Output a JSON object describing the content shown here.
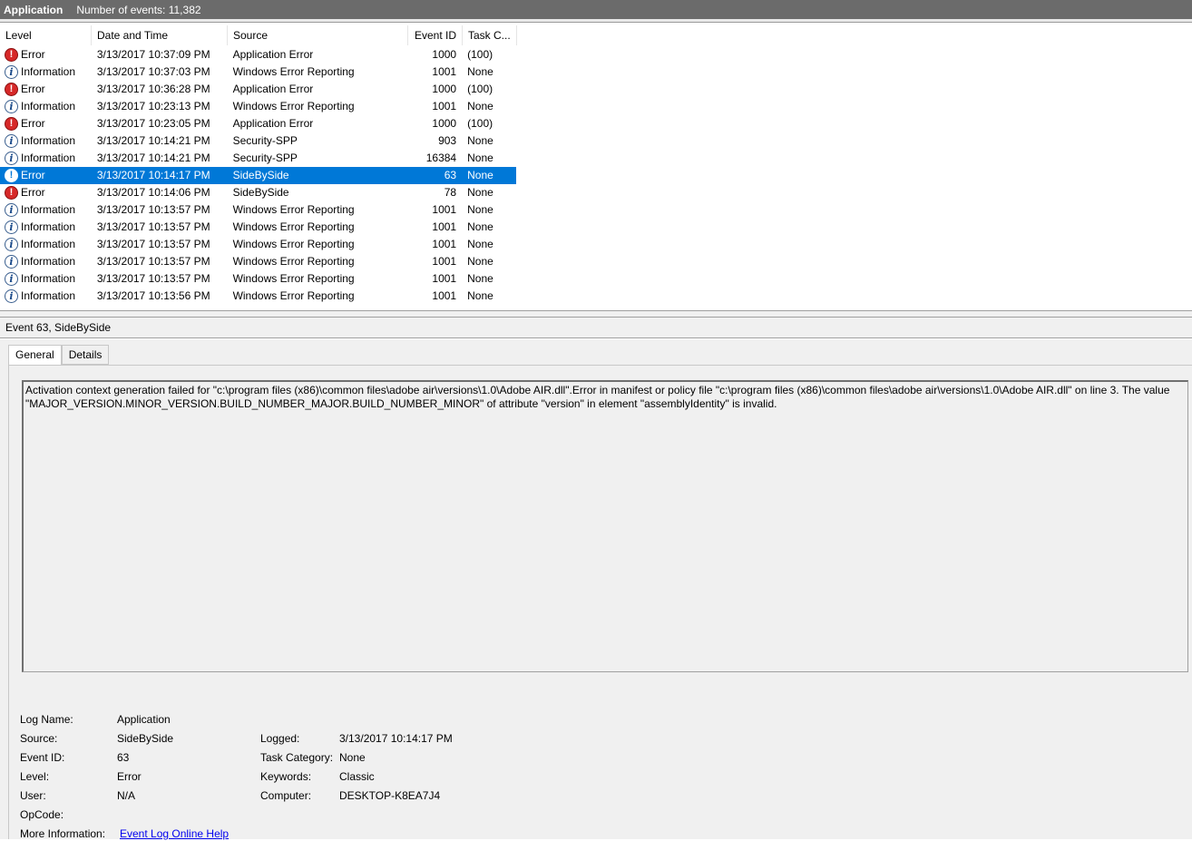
{
  "title": {
    "log_name": "Application",
    "count_text": "Number of events: 11,382"
  },
  "columns": {
    "level": "Level",
    "date": "Date and Time",
    "source": "Source",
    "event_id": "Event ID",
    "task": "Task C..."
  },
  "events": [
    {
      "level": "Error",
      "date": "3/13/2017 10:37:09 PM",
      "source": "Application Error",
      "event_id": "1000",
      "task": "(100)"
    },
    {
      "level": "Information",
      "date": "3/13/2017 10:37:03 PM",
      "source": "Windows Error Reporting",
      "event_id": "1001",
      "task": "None"
    },
    {
      "level": "Error",
      "date": "3/13/2017 10:36:28 PM",
      "source": "Application Error",
      "event_id": "1000",
      "task": "(100)"
    },
    {
      "level": "Information",
      "date": "3/13/2017 10:23:13 PM",
      "source": "Windows Error Reporting",
      "event_id": "1001",
      "task": "None"
    },
    {
      "level": "Error",
      "date": "3/13/2017 10:23:05 PM",
      "source": "Application Error",
      "event_id": "1000",
      "task": "(100)"
    },
    {
      "level": "Information",
      "date": "3/13/2017 10:14:21 PM",
      "source": "Security-SPP",
      "event_id": "903",
      "task": "None"
    },
    {
      "level": "Information",
      "date": "3/13/2017 10:14:21 PM",
      "source": "Security-SPP",
      "event_id": "16384",
      "task": "None"
    },
    {
      "level": "Error",
      "date": "3/13/2017 10:14:17 PM",
      "source": "SideBySide",
      "event_id": "63",
      "task": "None"
    },
    {
      "level": "Error",
      "date": "3/13/2017 10:14:06 PM",
      "source": "SideBySide",
      "event_id": "78",
      "task": "None"
    },
    {
      "level": "Information",
      "date": "3/13/2017 10:13:57 PM",
      "source": "Windows Error Reporting",
      "event_id": "1001",
      "task": "None"
    },
    {
      "level": "Information",
      "date": "3/13/2017 10:13:57 PM",
      "source": "Windows Error Reporting",
      "event_id": "1001",
      "task": "None"
    },
    {
      "level": "Information",
      "date": "3/13/2017 10:13:57 PM",
      "source": "Windows Error Reporting",
      "event_id": "1001",
      "task": "None"
    },
    {
      "level": "Information",
      "date": "3/13/2017 10:13:57 PM",
      "source": "Windows Error Reporting",
      "event_id": "1001",
      "task": "None"
    },
    {
      "level": "Information",
      "date": "3/13/2017 10:13:57 PM",
      "source": "Windows Error Reporting",
      "event_id": "1001",
      "task": "None"
    },
    {
      "level": "Information",
      "date": "3/13/2017 10:13:56 PM",
      "source": "Windows Error Reporting",
      "event_id": "1001",
      "task": "None"
    }
  ],
  "selected_index": 7,
  "detail": {
    "header": "Event 63, SideBySide",
    "tabs": [
      "General",
      "Details"
    ],
    "active_tab": "General",
    "description": "Activation context generation failed for \"c:\\program files (x86)\\common files\\adobe air\\versions\\1.0\\Adobe AIR.dll\".Error in manifest or policy file \"c:\\program files (x86)\\common files\\adobe air\\versions\\1.0\\Adobe AIR.dll\" on line 3. The value \"MAJOR_VERSION.MINOR_VERSION.BUILD_NUMBER_MAJOR.BUILD_NUMBER_MINOR\" of attribute \"version\" in element \"assemblyIdentity\" is invalid.",
    "log_name_label": "Log Name:",
    "log_name": "Application",
    "source_label": "Source:",
    "source": "SideBySide",
    "logged_label": "Logged:",
    "logged": "3/13/2017 10:14:17 PM",
    "event_id_label": "Event ID:",
    "event_id": "63",
    "task_category_label": "Task Category:",
    "task_category": "None",
    "level_label": "Level:",
    "level": "Error",
    "keywords_label": "Keywords:",
    "keywords": "Classic",
    "user_label": "User:",
    "user": "N/A",
    "computer_label": "Computer:",
    "computer": "DESKTOP-K8EA7J4",
    "opcode_label": "OpCode:",
    "opcode": "",
    "more_info_label": "More Information:",
    "more_info_link": "Event Log Online Help"
  },
  "colors": {
    "selection": "#0078d7",
    "title_bar": "#6b6b6b",
    "error_icon": "#d62828",
    "panel_bg": "#f0f0f0"
  },
  "icons": {
    "error": "error-icon",
    "information": "information-icon"
  }
}
